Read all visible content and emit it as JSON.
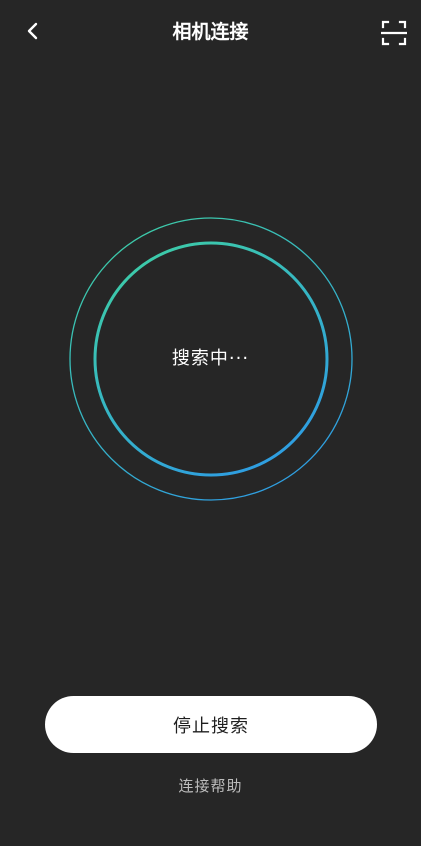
{
  "header": {
    "title": "相机连接",
    "back_icon": "chevron-left-icon",
    "scan_icon": "scan-icon"
  },
  "search": {
    "status": "搜索中···"
  },
  "actions": {
    "stop_label": "停止搜索",
    "help_label": "连接帮助"
  },
  "colors": {
    "background": "#262626",
    "ring_start": "#3fd1a0",
    "ring_end": "#2f9fe0",
    "button_bg": "#ffffff",
    "help_text": "#bdbdbd"
  }
}
